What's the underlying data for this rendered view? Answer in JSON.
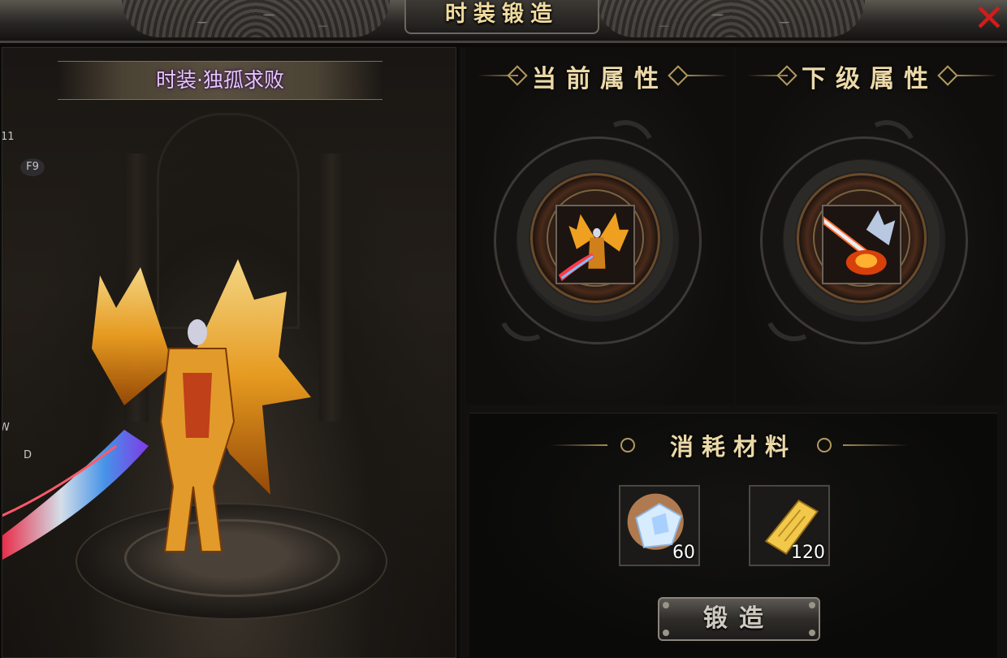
{
  "window": {
    "title": "时装锻造"
  },
  "left": {
    "fashion_name": "时装·独孤求败",
    "hotkeys": {
      "top": "11",
      "f9": "F9",
      "w": "W",
      "d": "D"
    }
  },
  "attributes": {
    "current_title": "当前属性",
    "next_title": "下级属性"
  },
  "materials": {
    "title": "消耗材料",
    "items": [
      {
        "icon": "crystal-shard-icon",
        "count": "60"
      },
      {
        "icon": "gold-talisman-icon",
        "count": "120"
      }
    ]
  },
  "actions": {
    "forge_label": "锻造"
  },
  "colors": {
    "title_gold": "#f0dca0",
    "name_purple": "#e8c4ff",
    "close_red": "#d21c1c"
  }
}
